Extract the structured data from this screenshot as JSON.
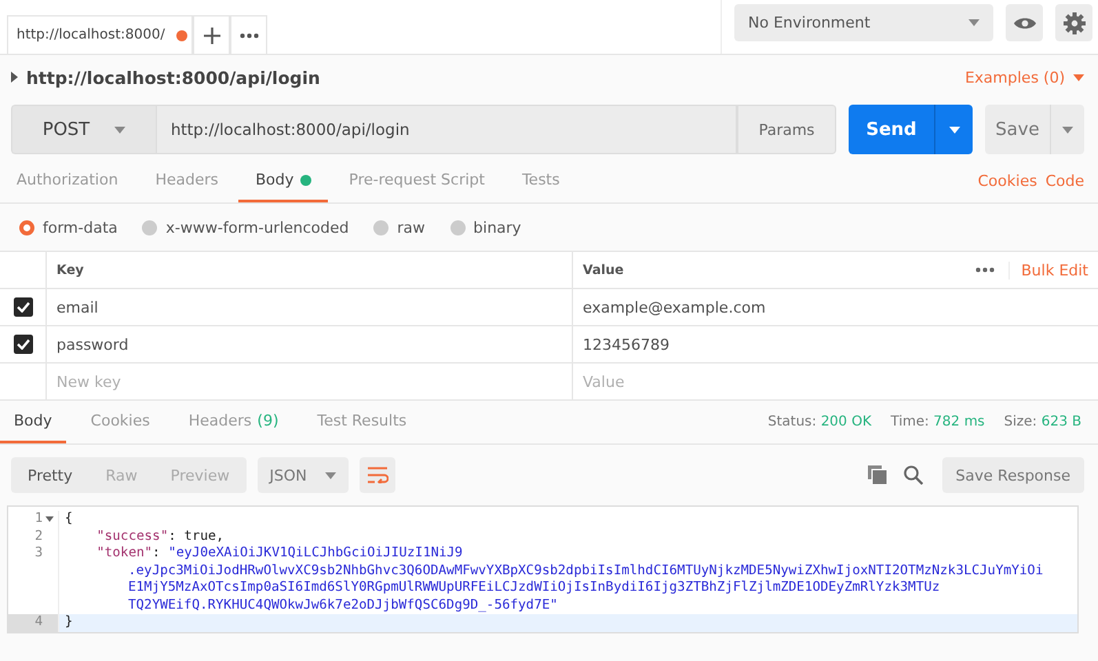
{
  "request_tabs": [
    {
      "label": "http://localhost:8000/",
      "unsaved": true,
      "selected": true
    }
  ],
  "environment": {
    "value": "No Environment"
  },
  "request": {
    "title": "http://localhost:8000/api/login",
    "examples": "Examples (0)",
    "method": "POST",
    "url": "http://localhost:8000/api/login",
    "params": "Params",
    "send": "Send",
    "save": "Save"
  },
  "request_sections": [
    {
      "label": "Authorization",
      "selected": false,
      "has_content": false
    },
    {
      "label": "Headers",
      "selected": false,
      "has_content": false
    },
    {
      "label": "Body",
      "selected": true,
      "has_content": true
    },
    {
      "label": "Pre-request Script",
      "selected": false,
      "has_content": false
    },
    {
      "label": "Tests",
      "selected": false,
      "has_content": false
    }
  ],
  "links": [
    "Cookies",
    "Code"
  ],
  "body_types": [
    {
      "label": "form-data",
      "selected": true
    },
    {
      "label": "x-www-form-urlencoded",
      "selected": false
    },
    {
      "label": "raw",
      "selected": false
    },
    {
      "label": "binary",
      "selected": false
    }
  ],
  "form_table": {
    "columns": [
      "Key",
      "Value"
    ],
    "bulk_edit": "Bulk Edit",
    "rows": [
      {
        "key": "email",
        "value": "example@example.com",
        "checked": true
      },
      {
        "key": "password",
        "value": "123456789",
        "checked": true
      }
    ],
    "new_row": {
      "key_placeholder": "New key",
      "value_placeholder": "Value"
    }
  },
  "response_tabs": [
    {
      "label": "Body",
      "selected": true
    },
    {
      "label": "Cookies",
      "selected": false
    },
    {
      "label": "Headers",
      "count": "(9)",
      "selected": false
    },
    {
      "label": "Test Results",
      "selected": false
    }
  ],
  "response_stats": [
    {
      "label": "Status:",
      "value": "200 OK"
    },
    {
      "label": "Time:",
      "value": "782 ms"
    },
    {
      "label": "Size:",
      "value": "623 B"
    }
  ],
  "view_modes": [
    {
      "label": "Pretty",
      "selected": true
    },
    {
      "label": "Raw",
      "selected": false
    },
    {
      "label": "Preview",
      "selected": false
    }
  ],
  "format": "JSON",
  "save_response": "Save Response",
  "code_lines": [
    {
      "number": "1",
      "parts": [
        {
          "kind": "punct",
          "text": "{"
        }
      ],
      "foldable": true,
      "current": false
    },
    {
      "number": "2",
      "parts": [
        {
          "kind": "key",
          "text": "\"success\""
        },
        {
          "kind": "punct",
          "text": ": true,"
        }
      ],
      "foldable": false,
      "current": false
    },
    {
      "number": "3",
      "parts": [
        {
          "kind": "key",
          "text": "\"token\""
        },
        {
          "kind": "punct",
          "text": ": "
        },
        {
          "kind": "string",
          "text": "\"eyJ0eXAiOiJKV1QiLCJhbGciOiJIUzI1NiJ9"
        }
      ],
      "foldable": false,
      "current": false,
      "continuation": [
        ".eyJpc3MiOiJodHRwOlwvXC9sb2NhbGhvc3Q6ODAwMFwvYXBpXC9sb2dpbiIsImlhdCI6MTUyNjkzMDE5NywiZXhwIjoxNTI2OTMzNzk3LCJuYmYiOi",
        "E1MjY5MzAxOTcsImp0aSI6Imd6SlY0RGpmUlRWWUpURFEiLCJzdWIiOjIsInBydiI6Ijg3ZTBhZjFlZjlmZDE1ODEyZmRlYzk3MTUz",
        "TQ2YWEifQ.RYKHUC4QWOkwJw6k7e2oDJjbWfQSC6Dg9D_-56fyd7E\""
      ]
    },
    {
      "number": "4",
      "parts": [
        {
          "kind": "punct",
          "text": "}"
        }
      ],
      "foldable": false,
      "current": true
    }
  ]
}
